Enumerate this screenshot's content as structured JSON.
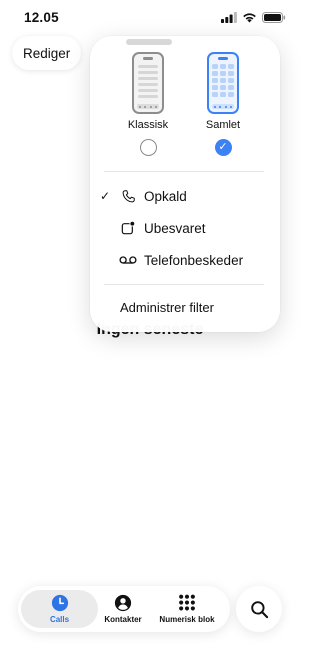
{
  "status_bar": {
    "time": "12.05"
  },
  "header": {
    "edit_label": "Rediger"
  },
  "main": {
    "empty_title": "Ingen seneste"
  },
  "popover": {
    "layouts": [
      {
        "label": "Klassisk",
        "selected": false
      },
      {
        "label": "Samlet",
        "selected": true
      }
    ],
    "items": [
      {
        "label": "Opkald",
        "icon": "phone-icon",
        "checked": true
      },
      {
        "label": "Ubesvaret",
        "icon": "missed-badge-icon",
        "checked": false
      },
      {
        "label": "Telefonbeskeder",
        "icon": "voicemail-icon",
        "checked": false
      }
    ],
    "check_glyph": "✓",
    "filter_label": "Administrer filter"
  },
  "tabbar": {
    "tabs": [
      {
        "label": "Calls",
        "icon": "clock-icon",
        "selected": true
      },
      {
        "label": "Kontakter",
        "icon": "person-icon",
        "selected": false
      },
      {
        "label": "Numerisk blok",
        "icon": "keypad-icon",
        "selected": false
      }
    ],
    "search_icon": "search-icon"
  },
  "colors": {
    "accent": "#3b82f6",
    "tab_selected_text": "#2f74e6"
  }
}
